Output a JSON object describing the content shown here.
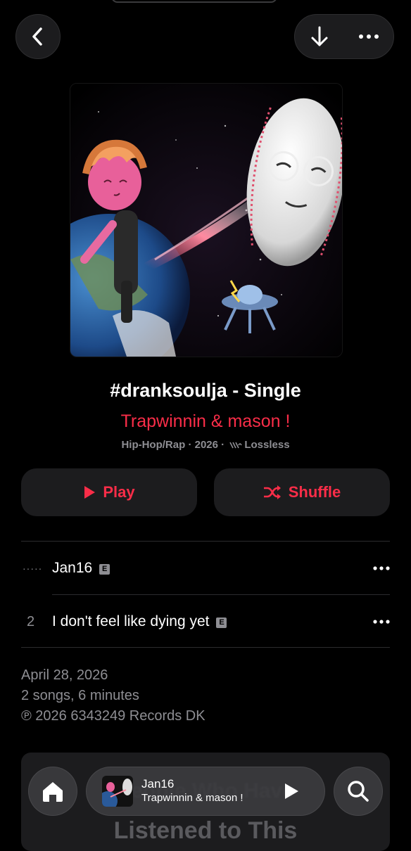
{
  "nav": {
    "back_icon": "chevron-left-icon",
    "download_icon": "arrow-down-icon",
    "more_icon": "ellipsis-icon"
  },
  "album": {
    "title": "#dranksoulja - Single",
    "artist": "Trapwinnin & mason !",
    "genre": "Hip-Hop/Rap",
    "year": "2026",
    "quality": "Lossless",
    "separator": "·"
  },
  "actions": {
    "play_label": "Play",
    "shuffle_label": "Shuffle"
  },
  "tracks": [
    {
      "number": "",
      "playing": true,
      "title": "Jan16",
      "explicit": "E"
    },
    {
      "number": "2",
      "playing": false,
      "title": "I don't feel like dying yet",
      "explicit": "E"
    }
  ],
  "info": {
    "release_date": "April 28, 2026",
    "summary": "2 songs, 6 minutes",
    "copyright": "℗ 2026 6343249 Records DK"
  },
  "background_card": {
    "line1": "People Who Have",
    "line2": "Listened to This"
  },
  "mini_player": {
    "title": "Jan16",
    "artist": "Trapwinnin & mason !"
  },
  "colors": {
    "accent": "#fa2d48",
    "background": "#000000",
    "secondary_text": "#8e8e93"
  }
}
